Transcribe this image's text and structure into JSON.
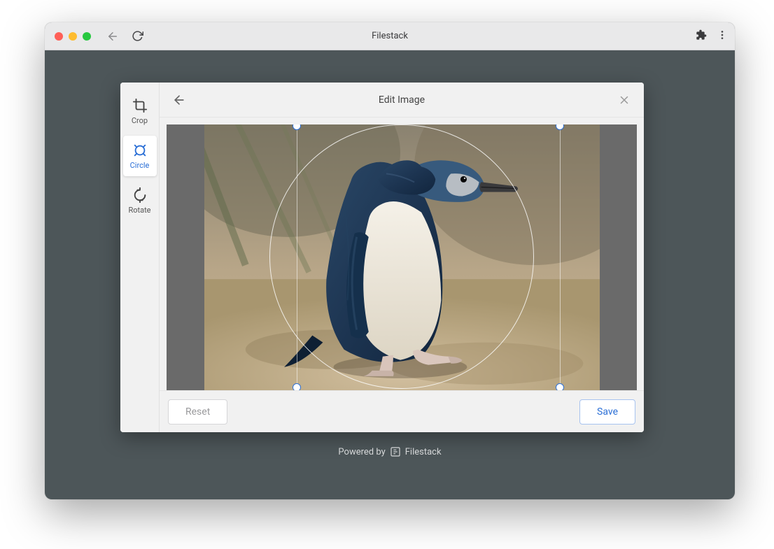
{
  "window": {
    "title": "Filestack"
  },
  "editor": {
    "header_title": "Edit Image"
  },
  "sidebar": {
    "tools": [
      {
        "label": "Crop"
      },
      {
        "label": "Circle"
      },
      {
        "label": "Rotate"
      }
    ],
    "active_tool": "Circle"
  },
  "footer": {
    "reset_label": "Reset",
    "save_label": "Save"
  },
  "powered": {
    "prefix": "Powered by",
    "brand": "Filestack"
  },
  "image": {
    "description": "penguin walking on sand"
  },
  "colors": {
    "accent": "#2b6fd6"
  }
}
